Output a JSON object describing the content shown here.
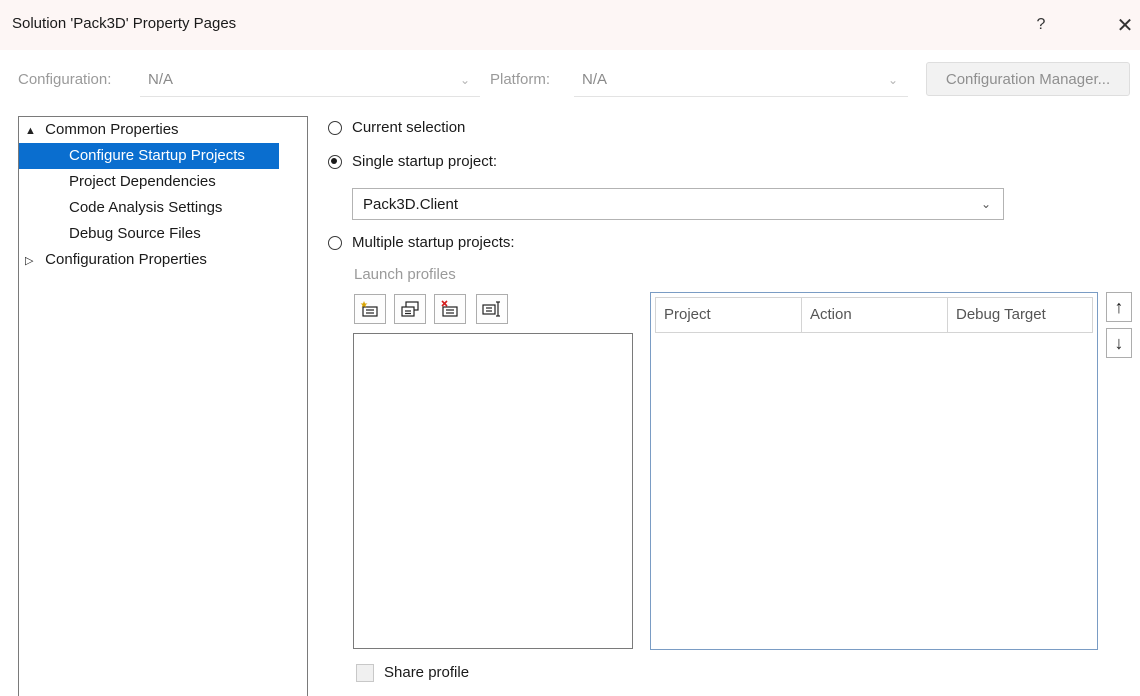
{
  "window": {
    "title": "Solution 'Pack3D' Property Pages",
    "help_label": "?",
    "close_label": "✕"
  },
  "config_bar": {
    "configuration_label": "Configuration:",
    "configuration_value": "N/A",
    "platform_label": "Platform:",
    "platform_value": "N/A",
    "configuration_manager_label": "Configuration Manager..."
  },
  "tree": {
    "items": [
      {
        "label": "Common Properties",
        "expander": "▲"
      },
      {
        "label": "Configure Startup Projects"
      },
      {
        "label": "Project Dependencies"
      },
      {
        "label": "Code Analysis Settings"
      },
      {
        "label": "Debug Source Files"
      },
      {
        "label": "Configuration Properties",
        "expander": "▷"
      }
    ]
  },
  "startup": {
    "current_selection_label": "Current selection",
    "single_startup_label": "Single startup project:",
    "single_startup_value": "Pack3D.Client",
    "multiple_startup_label": "Multiple startup projects:",
    "selected_option": "single",
    "launch_profiles_label": "Launch profiles"
  },
  "grid": {
    "columns": [
      "Project",
      "Action",
      "Debug Target"
    ],
    "rows": []
  },
  "move_up_label": "↑",
  "move_down_label": "↓",
  "share_profile_label": "Share profile",
  "colors": {
    "selection": "#0a6ecf",
    "titlebar": "#fdf6f5"
  }
}
